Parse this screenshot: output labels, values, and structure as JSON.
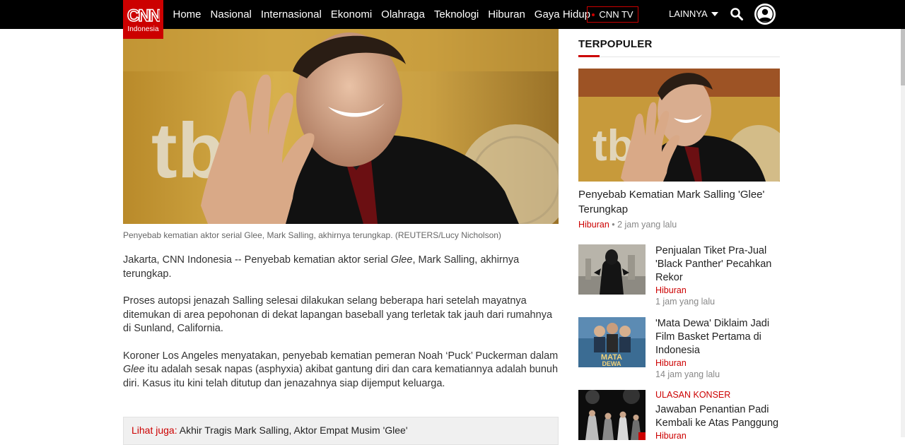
{
  "header": {
    "logo_main": "CNN",
    "logo_sub": "Indonesia",
    "nav": [
      "Home",
      "Nasional",
      "Internasional",
      "Ekonomi",
      "Olahraga",
      "Teknologi",
      "Hiburan",
      "Gaya Hidup"
    ],
    "cnntv_label": "CNN TV",
    "more_label": "LAINNYA"
  },
  "article": {
    "caption": "Penyebab kematian aktor serial Glee, Mark Salling, akhirnya terungkap. (REUTERS/Lucy Nicholson)",
    "p1_a": "Jakarta, CNN Indonesia -- Penyebab kematian aktor serial ",
    "p1_i": "Glee",
    "p1_b": ", Mark Salling, akhirnya terungkap.",
    "p2": "Proses autopsi jenazah Salling selesai dilakukan selang beberapa hari setelah mayatnya ditemukan di area pepohonan di dekat lapangan baseball yang terletak tak jauh dari rumahnya di Sunland, California.",
    "p3_a": "Koroner Los Angeles menyatakan, penyebab kematian pemeran Noah ‘Puck’ Puckerman dalam ",
    "p3_i": "Glee",
    "p3_b": " itu adalah sesak napas (asphyxia) akibat gantung diri dan cara kematiannya adalah bunuh diri. Kasus itu kini telah ditutup dan jenazahnya siap dijemput keluarga.",
    "see_also_label": "Lihat juga:",
    "see_also_text": " Akhir Tragis Mark Salling, Aktor Empat Musim 'Glee'"
  },
  "sidebar": {
    "title": "TERPOPULER",
    "featured": {
      "title": "Penyebab Kematian Mark Salling 'Glee' Terungkap",
      "category": "Hiburan",
      "separator": " • ",
      "time": "2 jam yang lalu"
    },
    "items": [
      {
        "kicker": "",
        "title": "Penjualan Tiket Pra-Jual 'Black Panther' Pecahkan Rekor",
        "category": "Hiburan",
        "time": "1 jam yang lalu"
      },
      {
        "kicker": "",
        "title": "'Mata Dewa' Diklaim Jadi Film Basket Pertama di Indonesia",
        "category": "Hiburan",
        "time": "14 jam yang lalu"
      },
      {
        "kicker": "ULASAN KONSER",
        "title": "Jawaban Penantian Padi Kembali ke Atas Panggung",
        "category": "Hiburan",
        "time": ""
      }
    ]
  },
  "colors": {
    "brand_red": "#cc0000",
    "topbar": "#000000"
  },
  "icons": {
    "search": "search-icon",
    "user": "user-icon",
    "dropdown": "caret-down-icon"
  }
}
